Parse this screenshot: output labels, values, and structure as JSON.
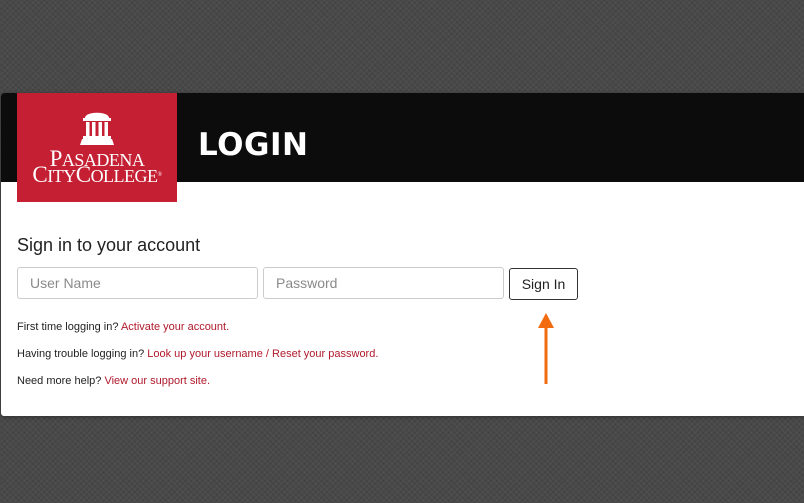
{
  "header": {
    "title": "LOGIN",
    "logo": {
      "line1_cap": "P",
      "line1_rest": "ASADENA",
      "line2_cap1": "C",
      "line2_rest1": "ITY",
      "line2_cap2": "C",
      "line2_rest2": "OLLEGE",
      "registered": "®",
      "color": "#c41f33"
    }
  },
  "form": {
    "heading": "Sign in to your account",
    "username_placeholder": "User Name",
    "password_placeholder": "Password",
    "submit_label": "Sign In"
  },
  "help": [
    {
      "text": "First time logging in? ",
      "link1": "Activate your account."
    },
    {
      "text": "Having trouble logging in? ",
      "link1": "Look up your username",
      "sep": " / ",
      "link2": "Reset your password."
    },
    {
      "text": "Need more help? ",
      "link1": "View our support site."
    }
  ],
  "annotation": {
    "arrow_color": "#f26b0f",
    "icon": "up-arrow-icon"
  },
  "colors": {
    "link": "#b0192b",
    "header_bg": "#0c0c0c",
    "background": "#474747"
  }
}
